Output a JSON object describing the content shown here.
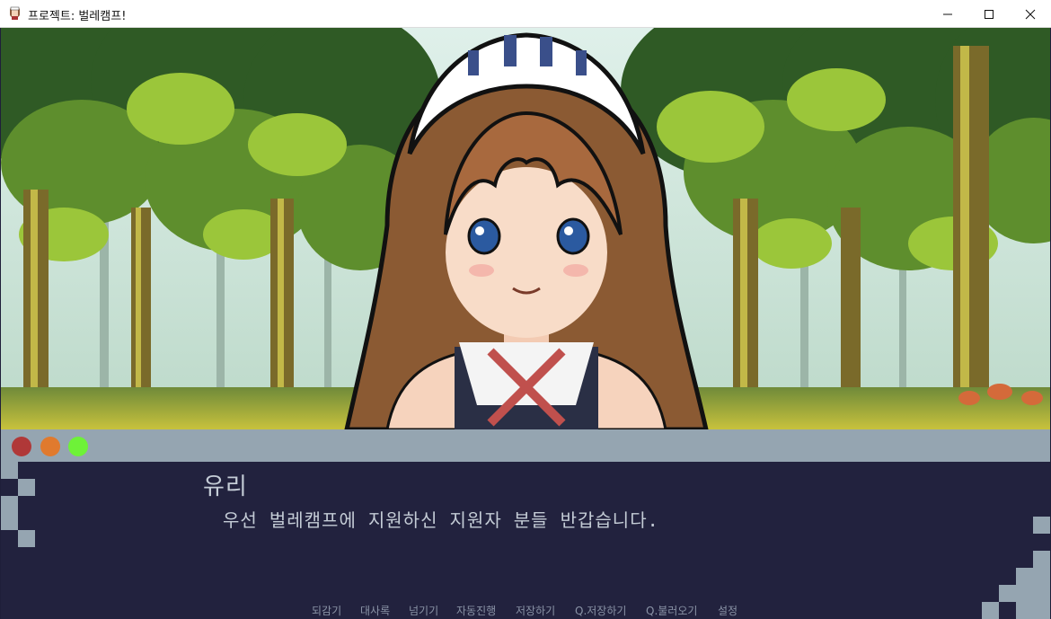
{
  "window": {
    "title": "프로젝트: 벌레캠프!",
    "controls": [
      "minimize-icon",
      "maximize-icon",
      "close-icon"
    ]
  },
  "scene": {
    "background": "forest",
    "character": "maid-girl-sprite"
  },
  "dialogue": {
    "speaker": "유리",
    "text": "우선 벌레캠프에 지원하신 지원자 분들 반갑습니다.",
    "dots": [
      "#b03838",
      "#e07a2e",
      "#6ef238"
    ]
  },
  "quick_menu": [
    {
      "label": "되감기",
      "key": "rollback"
    },
    {
      "label": "대사록",
      "key": "history"
    },
    {
      "label": "넘기기",
      "key": "skip"
    },
    {
      "label": "자동진행",
      "key": "auto"
    },
    {
      "label": "저장하기",
      "key": "save"
    },
    {
      "label": "Q.저장하기",
      "key": "quick-save"
    },
    {
      "label": "Q.불러오기",
      "key": "quick-load"
    },
    {
      "label": "설정",
      "key": "settings"
    }
  ],
  "colors": {
    "dialog_bg": "#22223e",
    "dialog_bar": "#95a5b1",
    "text": "#c4ccd6",
    "menu_text": "#8a93a6"
  }
}
